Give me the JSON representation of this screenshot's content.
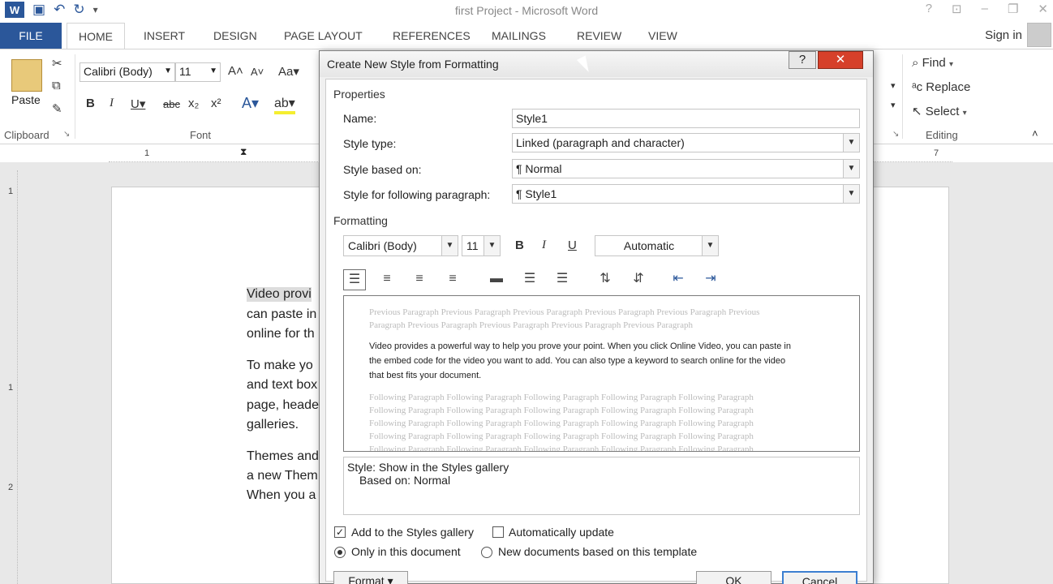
{
  "window": {
    "title": "first Project - Microsoft Word"
  },
  "qat": {
    "app_icon": "W",
    "save_icon": "save-icon",
    "undo_icon": "undo-icon",
    "redo_icon": "redo-icon"
  },
  "tabs": [
    {
      "label": "FILE"
    },
    {
      "label": "HOME"
    },
    {
      "label": "INSERT"
    },
    {
      "label": "DESIGN"
    },
    {
      "label": "PAGE LAYOUT"
    },
    {
      "label": "REFERENCES"
    },
    {
      "label": "MAILINGS"
    },
    {
      "label": "REVIEW"
    },
    {
      "label": "VIEW"
    }
  ],
  "account": {
    "signin": "Sign in"
  },
  "ribbon": {
    "paste_label": "Paste",
    "clipboard_label": "Clipboard",
    "font_label": "Font",
    "font_name": "Calibri (Body)",
    "font_size": "11",
    "editing_label": "Editing",
    "find": "Find",
    "replace": "Replace",
    "select": "Select"
  },
  "ruler": {
    "h_marks": [
      "1",
      "7"
    ],
    "v_marks": [
      "1",
      "1",
      "2"
    ]
  },
  "document": {
    "lines": [
      "Video provi",
      "can paste in",
      "online for th",
      "To make yo",
      "and text box",
      "page, heade",
      "galleries.",
      "Themes and",
      "a new Them",
      "When you a"
    ]
  },
  "dialog": {
    "title": "Create New Style from Formatting",
    "help": "?",
    "close": "✕",
    "properties_title": "Properties",
    "name_label": "Name:",
    "name_value": "Style1",
    "style_type_label": "Style type:",
    "style_type_value": "Linked (paragraph and character)",
    "based_on_label": "Style based on:",
    "based_on_value": "¶  Normal",
    "following_label": "Style for following paragraph:",
    "following_value": "¶  Style1",
    "formatting_title": "Formatting",
    "font_name": "Calibri (Body)",
    "font_size": "11",
    "bold": "B",
    "italic": "I",
    "underline": "U",
    "color": "Automatic",
    "preview": {
      "previous": [
        "Previous Paragraph Previous Paragraph Previous Paragraph Previous Paragraph Previous Paragraph Previous",
        "Paragraph Previous Paragraph Previous Paragraph Previous Paragraph Previous Paragraph"
      ],
      "sample": [
        "Video provides a powerful way to help you prove your point. When you click Online Video, you can paste in",
        "the embed code for the video you want to add. You can also type a keyword to search online for the video",
        "that best fits your document."
      ],
      "following": [
        "Following Paragraph Following Paragraph Following Paragraph Following Paragraph Following Paragraph",
        "Following Paragraph Following Paragraph Following Paragraph Following Paragraph Following Paragraph",
        "Following Paragraph Following Paragraph Following Paragraph Following Paragraph Following Paragraph",
        "Following Paragraph Following Paragraph Following Paragraph Following Paragraph Following Paragraph",
        "Following Paragraph Following Paragraph Following Paragraph Following Paragraph Following Paragraph"
      ]
    },
    "description_line1": "Style: Show in the Styles gallery",
    "description_line2": "Based on: Normal",
    "add_to_gallery": "Add to the Styles gallery",
    "auto_update": "Automatically update",
    "only_this_doc": "Only in this document",
    "new_docs": "New documents based on this template",
    "format_button": "Format ▾",
    "ok_button": "OK",
    "cancel_button": "Cancel",
    "add_to_gallery_checked": true,
    "auto_update_checked": false
  },
  "colors": {
    "brand": "#2b579a",
    "close_red": "#d6402a",
    "default_btn": "#3c7fd1"
  }
}
